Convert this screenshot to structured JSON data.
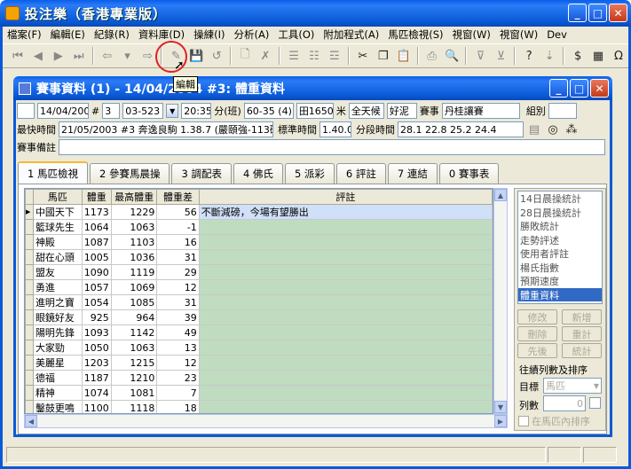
{
  "app": {
    "title": "投注樂（香港專業版）"
  },
  "menu": [
    "檔案(F)",
    "編輯(E)",
    "紀錄(R)",
    "資料庫(D)",
    "操練(I)",
    "分析(A)",
    "工具(O)",
    "附加程式(A)",
    "馬匹檢視(S)",
    "視窗(W)",
    "視窗(W)",
    "Dev"
  ],
  "tooltip": "編輯",
  "mdi": {
    "title": "賽事資料 (1) - 14/04/2004 #3: 體重資料"
  },
  "race": {
    "date": "14/04/2004",
    "hash": "#",
    "race_no": "3",
    "code": "03-523",
    "time": "20:35",
    "class_label": "分(班)",
    "class_value": "60-35 (4)",
    "field": "田1650",
    "m_label": "米",
    "weather": "全天候",
    "going": "好泥",
    "race_label": "賽事",
    "race_name": "丹桂讓賽",
    "group_label": "組別",
    "group_value": "",
    "fastest_label": "最快時間",
    "fastest_value": "21/05/2003 #3 奔逸良駒 1.38.7 (嚴頤強-113磅)",
    "standard_label": "標準時間",
    "standard_value": "1.40.0",
    "split_label": "分段時間",
    "split_value": "28.1  22.8  25.2  24.4",
    "remark_label": "賽事備註",
    "remark_value": ""
  },
  "tabs": [
    "1 馬匹檢視",
    "2 參賽馬晨操",
    "3 調配表",
    "4 佛氏",
    "5 派彩",
    "6 評註",
    "7 連結",
    "0 賽事表"
  ],
  "grid": {
    "headers": [
      "馬匹",
      "體重",
      "最高體重",
      "體重差",
      "評註"
    ],
    "rows": [
      {
        "horse": "中國天下",
        "weight": "1173",
        "max": "1229",
        "diff": "56",
        "comment": "不斷減磅，今場有望勝出"
      },
      {
        "horse": "籃球先生",
        "weight": "1064",
        "max": "1063",
        "diff": "-1",
        "comment": ""
      },
      {
        "horse": "神殿",
        "weight": "1087",
        "max": "1103",
        "diff": "16",
        "comment": ""
      },
      {
        "horse": "甜在心頭",
        "weight": "1005",
        "max": "1036",
        "diff": "31",
        "comment": ""
      },
      {
        "horse": "盟友",
        "weight": "1090",
        "max": "1119",
        "diff": "29",
        "comment": ""
      },
      {
        "horse": "勇進",
        "weight": "1057",
        "max": "1069",
        "diff": "12",
        "comment": ""
      },
      {
        "horse": "進明之寶",
        "weight": "1054",
        "max": "1085",
        "diff": "31",
        "comment": ""
      },
      {
        "horse": "眼鏡好友",
        "weight": "925",
        "max": "964",
        "diff": "39",
        "comment": ""
      },
      {
        "horse": "陽明先鋒",
        "weight": "1093",
        "max": "1142",
        "diff": "49",
        "comment": ""
      },
      {
        "horse": "大家勁",
        "weight": "1050",
        "max": "1063",
        "diff": "13",
        "comment": ""
      },
      {
        "horse": "美麗星",
        "weight": "1203",
        "max": "1215",
        "diff": "12",
        "comment": ""
      },
      {
        "horse": "德福",
        "weight": "1187",
        "max": "1210",
        "diff": "23",
        "comment": ""
      },
      {
        "horse": "精神",
        "weight": "1074",
        "max": "1081",
        "diff": "7",
        "comment": ""
      },
      {
        "horse": "鑿鼓更鳴",
        "weight": "1100",
        "max": "1118",
        "diff": "18",
        "comment": ""
      }
    ]
  },
  "side": {
    "list": [
      "14日晨操統計",
      "28日晨操統計",
      "勝敗統計",
      "走勢評述",
      "使用者評註",
      "楊氏指數",
      "預期速度",
      "體重資料"
    ],
    "buttons": {
      "edit": "修改",
      "add": "新增",
      "delete": "刪除",
      "reset": "重計",
      "priority": "先後",
      "stats": "統計"
    },
    "sort_title": "往績列數及排序",
    "target_label": "目標",
    "target_value": "馬匹",
    "count_label": "列數",
    "count_value": "0",
    "sort_in_horse": "在馬匹內排序"
  }
}
